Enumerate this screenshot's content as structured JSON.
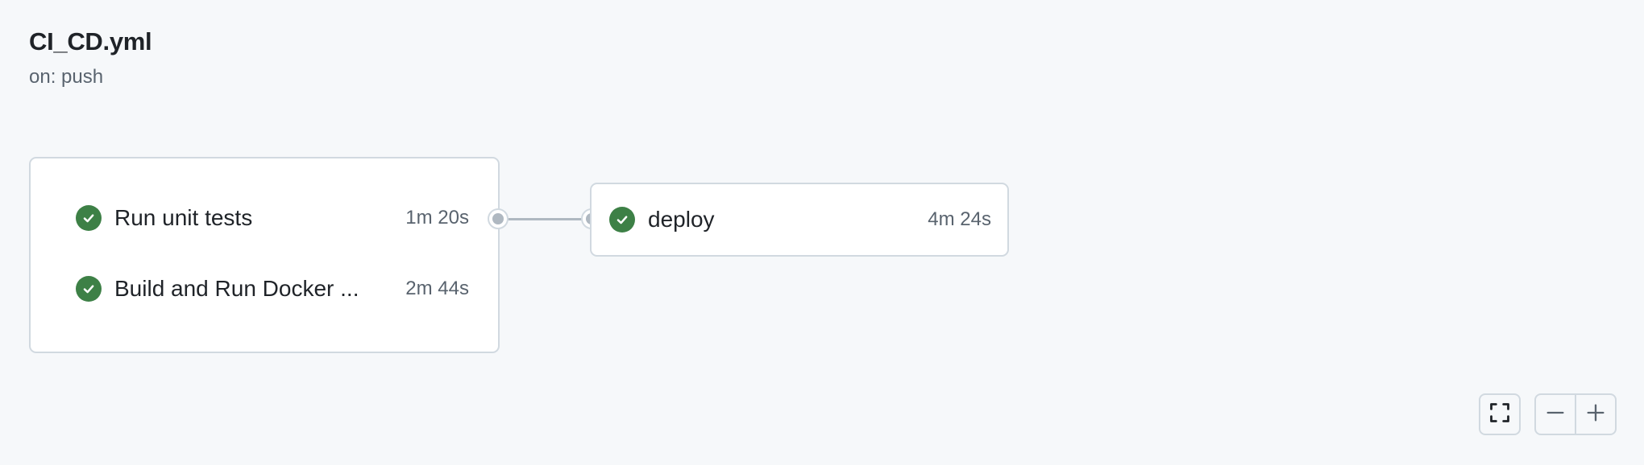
{
  "workflow": {
    "title": "CI_CD.yml",
    "trigger": "on: push"
  },
  "jobs": [
    {
      "name": "Run unit tests",
      "duration": "1m 20s",
      "status": "success",
      "status_icon": "check-circle-icon"
    },
    {
      "name": "Build and Run Docker ...",
      "duration": "2m 44s",
      "status": "success",
      "status_icon": "check-circle-icon"
    },
    {
      "name": "deploy",
      "duration": "4m 24s",
      "status": "success",
      "status_icon": "check-circle-icon"
    }
  ],
  "controls": {
    "fullscreen_icon": "fullscreen-icon",
    "zoom_out_icon": "minus-icon",
    "zoom_in_icon": "plus-icon"
  },
  "colors": {
    "success": "#3d8046",
    "border": "#d1d9e0",
    "connector": "#afb8c1",
    "background": "#f6f8fa"
  }
}
